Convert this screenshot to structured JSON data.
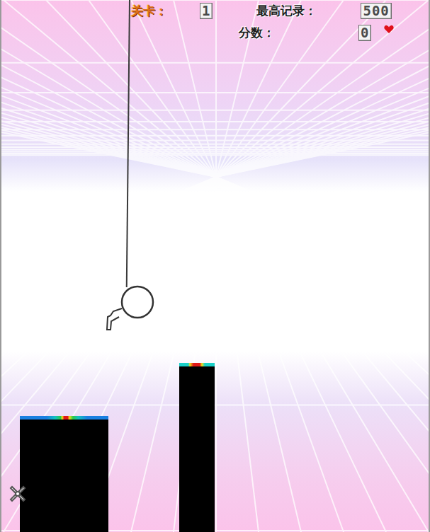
{
  "hud": {
    "level_label": "关卡：",
    "level": "1",
    "best_label": "最高记录：",
    "best": "500",
    "score_label": "分数：",
    "score": "0"
  },
  "lives": [
    {
      "alive": true
    }
  ],
  "player": {
    "on_rope": true
  }
}
